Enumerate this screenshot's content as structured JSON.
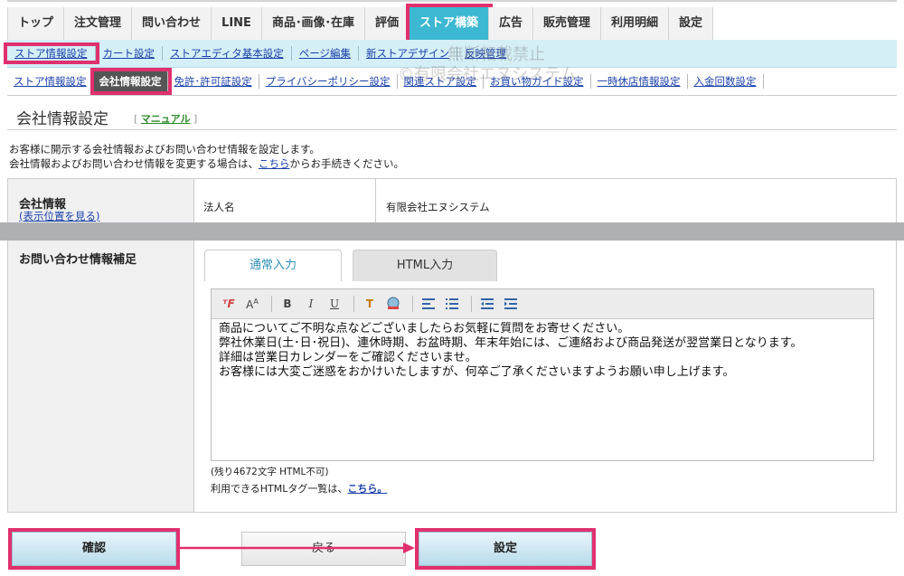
{
  "top_nav": [
    "トップ",
    "注文管理",
    "問い合わせ",
    "LINE",
    "商品･画像･在庫",
    "評価",
    "ストア構築",
    "広告",
    "販売管理",
    "利用明細",
    "設定"
  ],
  "sub_nav": [
    "ストア情報設定",
    "カート設定",
    "ストアエディタ基本設定",
    "ページ編集",
    "新ストアデザイン",
    "反映管理"
  ],
  "third_nav": [
    "ストア情報設定",
    "会社情報設定",
    "免許･許可証設定",
    "プライバシーポリシー設定",
    "関連ストア設定",
    "お買い物ガイド設定",
    "一時休店情報設定",
    "入金回数設定"
  ],
  "watermark": {
    "line1": "無断転載禁止",
    "line2": "©有限会社エヌシステム"
  },
  "page": {
    "title": "会社情報設定",
    "manual_link": "マニュアル",
    "desc1": "お客様に開示する会社情報およびお問い合わせ情報を設定します。",
    "desc2_pre": "会社情報およびお問い合わせ情報を変更する場合は、",
    "desc2_link": "こちら",
    "desc2_post": "からお手続きください。"
  },
  "company": {
    "label": "会社情報",
    "sublink": "(表示位置を見る)",
    "field": "法人名",
    "value": "有限会社エヌシステム"
  },
  "inquiry": {
    "label": "お問い合わせ情報補足",
    "tab_normal": "通常入力",
    "tab_html": "HTML入力",
    "lines": [
      "商品についてご不明な点などございましたらお気軽に質問をお寄せください。",
      "弊社休業日(土･日･祝日)、連休時期、お盆時期、年末年始には、ご連絡および商品発送が翌営業日となります。",
      "詳細は営業日カレンダーをご確認くださいませ。",
      "お客様には大変ご迷惑をおかけいたしますが、何卒ご了承くださいますようお願い申し上げます。"
    ],
    "remaining": "(残り4672文字 HTML不可)",
    "tags_pre": "利用できるHTMLタグ一覧は、",
    "tags_link": "こちら。"
  },
  "buttons": {
    "confirm": "確認",
    "back": "戻る",
    "set": "設定"
  },
  "colors": {
    "highlight": "#e0306e",
    "active_tab": "#3cb8d2",
    "subnav_bg": "#d4eff6"
  }
}
